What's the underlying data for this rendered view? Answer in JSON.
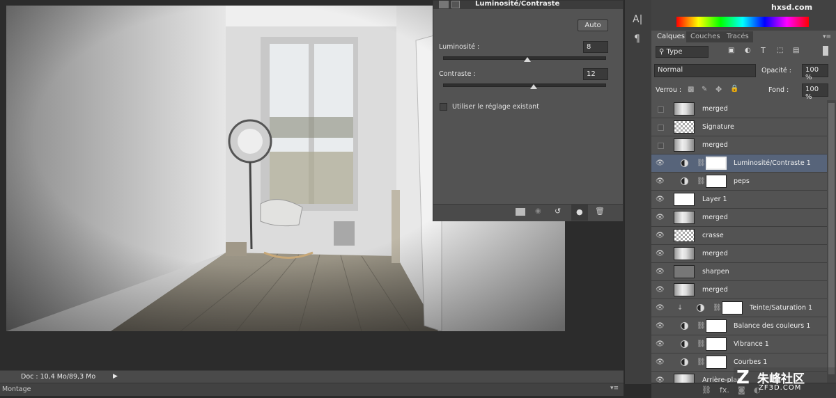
{
  "properties": {
    "title": "Luminosité/Contraste",
    "auto_label": "Auto",
    "luminosite_label": "Luminosité :",
    "luminosite_value": "8",
    "luminosite_fraction": 0.52,
    "contraste_label": "Contraste :",
    "contraste_value": "12",
    "contraste_fraction": 0.56,
    "legacy_label": "Utiliser le réglage existant"
  },
  "status": {
    "doc": "Doc : 10,4 Mo/89,3 Mo",
    "montage": "Montage"
  },
  "layers_panel": {
    "tabs": [
      "Calques",
      "Couches",
      "Tracés"
    ],
    "filter": "Type",
    "blend_mode": "Normal",
    "opacity_label": "Opacité :",
    "opacity_value": "100 %",
    "lock_label": "Verrou :",
    "fill_label": "Fond :",
    "fill_value": "100 %",
    "layers": [
      {
        "name": "merged",
        "visible": false,
        "kind": "image"
      },
      {
        "name": "Signature",
        "visible": false,
        "kind": "checker"
      },
      {
        "name": "merged",
        "visible": false,
        "kind": "image"
      },
      {
        "name": "Luminosité/Contraste 1",
        "visible": true,
        "kind": "adjust",
        "selected": true
      },
      {
        "name": "peps",
        "visible": true,
        "kind": "adjust"
      },
      {
        "name": "Layer 1",
        "visible": true,
        "kind": "white"
      },
      {
        "name": "merged",
        "visible": true,
        "kind": "image"
      },
      {
        "name": "crasse",
        "visible": true,
        "kind": "checker"
      },
      {
        "name": "merged",
        "visible": true,
        "kind": "image"
      },
      {
        "name": "sharpen",
        "visible": true,
        "kind": "gray"
      },
      {
        "name": "merged",
        "visible": true,
        "kind": "image"
      },
      {
        "name": "Teinte/Saturation 1",
        "visible": true,
        "kind": "adjust",
        "clipped": true
      },
      {
        "name": "Balance des couleurs 1",
        "visible": true,
        "kind": "adjust"
      },
      {
        "name": "Vibrance 1",
        "visible": true,
        "kind": "adjust"
      },
      {
        "name": "Courbes 1",
        "visible": true,
        "kind": "adjust"
      },
      {
        "name": "Arrière-plan",
        "visible": true,
        "kind": "image"
      }
    ]
  },
  "watermarks": {
    "top": "hxsd.com",
    "bottom_cn": "朱峰社区",
    "bottom_en": "ZF3D.COM"
  }
}
